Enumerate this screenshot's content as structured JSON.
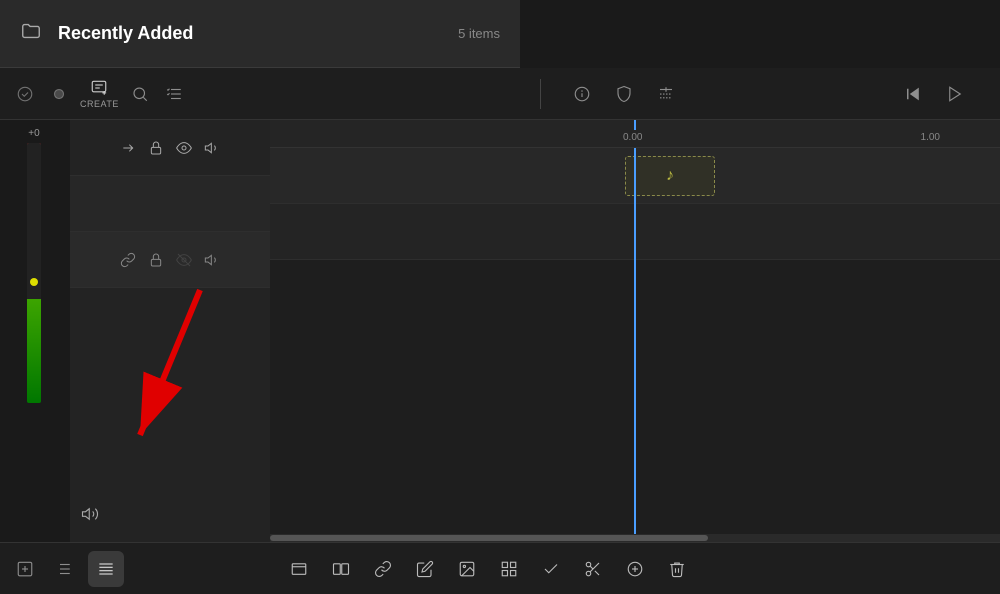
{
  "topPanel": {
    "title": "Recently Added",
    "itemCount": "5 items"
  },
  "toolbar": {
    "createLabel": "CREATE",
    "buttons": [
      "check",
      "record",
      "create",
      "search",
      "list-filter",
      "info",
      "shield",
      "add-marker"
    ]
  },
  "vuMeter": {
    "label": "+0"
  },
  "trackControls": {
    "track1": {
      "icons": [
        "arrow-right",
        "lock",
        "eye",
        "volume"
      ]
    },
    "track2": {
      "icons": [
        "link",
        "lock",
        "eye-off",
        "volume"
      ]
    }
  },
  "timeline": {
    "playheadPosition": "0.00",
    "markers": [
      "0.00",
      "1.00"
    ],
    "clipLabel": "audio"
  },
  "bottomToolbar": {
    "buttons": [
      "trim",
      "split",
      "link",
      "edit",
      "image",
      "grid",
      "check",
      "scissors",
      "add",
      "delete"
    ]
  },
  "bottomLeftToolbar": {
    "buttons": [
      "add-track",
      "list",
      "grid-bars"
    ]
  }
}
